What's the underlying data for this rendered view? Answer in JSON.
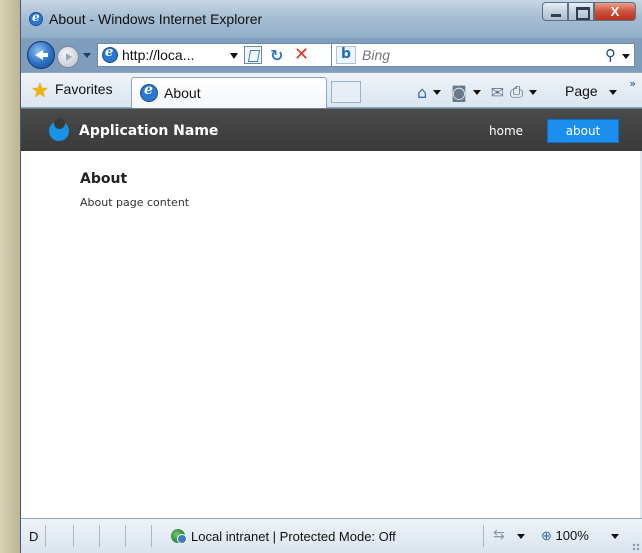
{
  "window": {
    "title": "About - Windows Internet Explorer",
    "close_glyph": "X"
  },
  "address": {
    "url": "http://loca...",
    "search_placeholder": "Bing",
    "bing_glyph": "b",
    "search_glyph": "⚲"
  },
  "toolbar": {
    "favorites_label": "Favorites",
    "tab_title": "About",
    "page_menu_label": "Page",
    "chevron_glyph": "»",
    "home_glyph": "⌂",
    "feeds_glyph": "◙",
    "mail_glyph": "✉",
    "print_glyph": "⎙"
  },
  "app": {
    "name": "Application Name",
    "nav": [
      {
        "label": "home",
        "active": false
      },
      {
        "label": "about",
        "active": true
      }
    ],
    "accent": "#1a8ff0"
  },
  "page": {
    "heading": "About",
    "body": "About page content"
  },
  "statusbar": {
    "left_text": "D",
    "zone": "Local intranet | Protected Mode: Off",
    "zoom": "100%",
    "security_glyph": "⇆",
    "zoom_glyph": "⊕"
  }
}
